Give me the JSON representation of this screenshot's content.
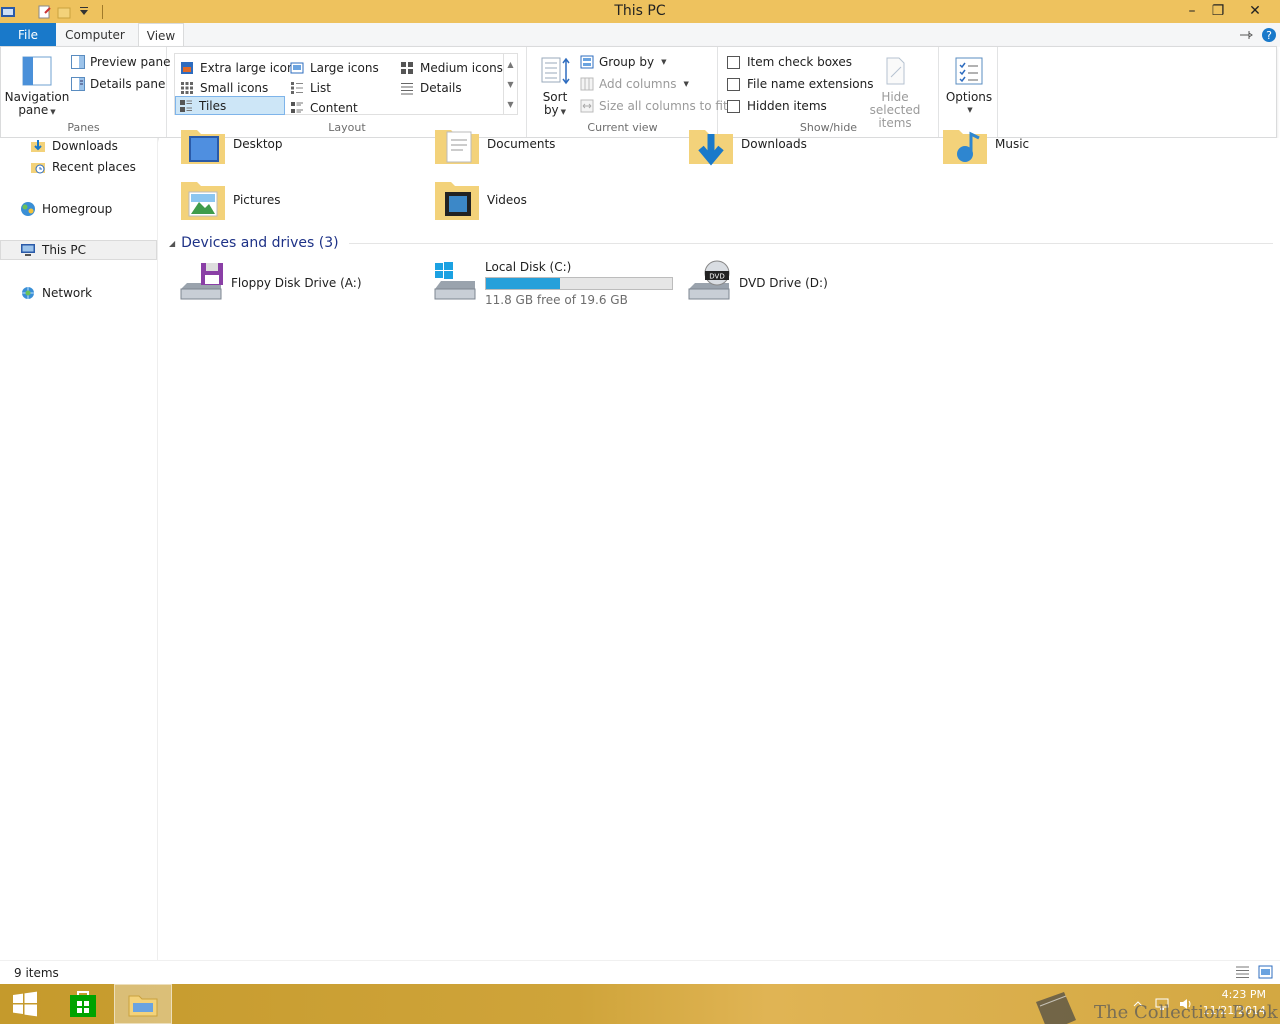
{
  "window": {
    "title": "This PC",
    "minimize": "–",
    "restore": "❐",
    "close": "✕"
  },
  "tabs": {
    "file": "File",
    "computer": "Computer",
    "view": "View"
  },
  "ribbon": {
    "panes": {
      "label": "Panes",
      "navigation_pane": "Navigation",
      "navigation_pane_2": "pane",
      "preview_pane": "Preview pane",
      "details_pane": "Details pane"
    },
    "layout": {
      "label": "Layout",
      "items": {
        "extra_large": "Extra large icons",
        "large": "Large icons",
        "medium": "Medium icons",
        "small": "Small icons",
        "list": "List",
        "details": "Details",
        "tiles": "Tiles",
        "content": "Content"
      },
      "selected": "Tiles"
    },
    "current_view": {
      "label": "Current view",
      "sort_by": "Sort",
      "sort_by_2": "by",
      "group_by": "Group by",
      "add_columns": "Add columns",
      "size_columns": "Size all columns to fit"
    },
    "show_hide": {
      "label": "Show/hide",
      "item_check_boxes": "Item check boxes",
      "file_name_extensions": "File name extensions",
      "hidden_items": "Hidden items",
      "hide_selected": "Hide selected",
      "hide_selected_2": "items"
    },
    "options": {
      "label": "Options"
    }
  },
  "nav": {
    "downloads": "Downloads",
    "recent_places": "Recent places",
    "homegroup": "Homegroup",
    "this_pc": "This PC",
    "network": "Network"
  },
  "folders": [
    "Desktop",
    "Documents",
    "Downloads",
    "Music",
    "Pictures",
    "Videos"
  ],
  "devices_header": "Devices and drives (3)",
  "drives": {
    "floppy": "Floppy Disk Drive (A:)",
    "local_disk": "Local Disk (C:)",
    "local_disk_free": "11.8 GB free of 19.6 GB",
    "local_disk_used_fraction": 0.398,
    "dvd": "DVD Drive (D:)"
  },
  "status": {
    "items": "9 items"
  },
  "taskbar": {
    "time": "4:23 PM",
    "date": "11/21/2014"
  },
  "watermark": "The Collection Book",
  "colors": {
    "titlebar": "#eec25e",
    "file_tab": "#1979ca",
    "drive_fill": "#26a0da",
    "group_header": "#1e3287"
  }
}
